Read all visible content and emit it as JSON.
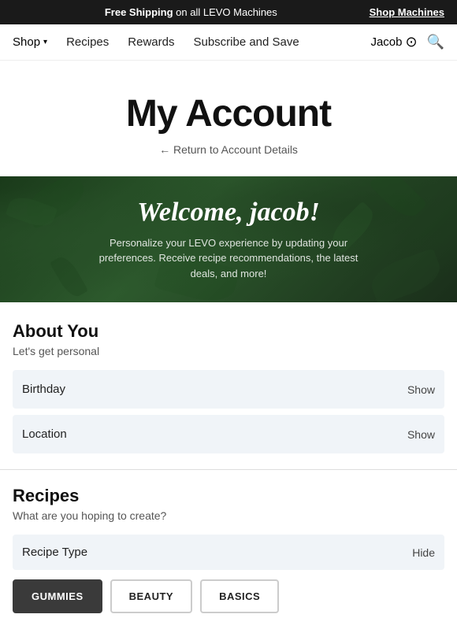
{
  "announcement": {
    "free_shipping_prefix": "Free Shipping",
    "free_shipping_suffix": " on all LEVO Machines",
    "shop_link_label": "Shop Machines"
  },
  "nav": {
    "shop_label": "Shop",
    "recipes_label": "Recipes",
    "rewards_label": "Rewards",
    "subscribe_label": "Subscribe and Save",
    "user_name": "Jacob"
  },
  "page": {
    "title": "My Account",
    "return_link": "← Return to Account Details"
  },
  "welcome": {
    "title": "Welcome, jacob!",
    "subtitle": "Personalize your LEVO experience by updating your preferences. Receive recipe recommendations, the latest deals, and more!"
  },
  "about_you": {
    "section_title": "About You",
    "section_subtitle": "Let's get personal",
    "rows": [
      {
        "label": "Birthday",
        "action": "Show"
      },
      {
        "label": "Location",
        "action": "Show"
      }
    ]
  },
  "recipes": {
    "section_title": "Recipes",
    "section_subtitle": "What are you hoping to create?",
    "type_row_label": "Recipe Type",
    "type_row_action": "Hide",
    "buttons": [
      {
        "label": "GUMMIES",
        "active": true
      },
      {
        "label": "BEAUTY",
        "active": false
      },
      {
        "label": "BASICS",
        "active": false
      }
    ]
  },
  "colors": {
    "dark_bg": "#1a1a1a",
    "active_btn_bg": "#3a3a3a",
    "info_row_bg": "#f0f4f8",
    "accent_green": "#2d5a2d"
  }
}
